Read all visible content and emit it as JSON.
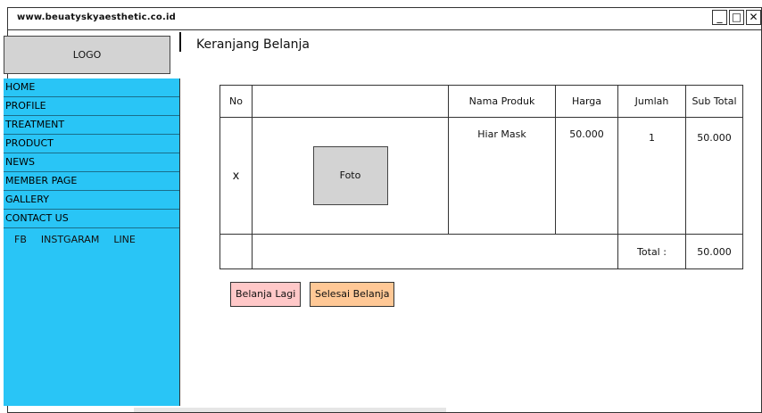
{
  "browser": {
    "url": "www.beuatyskyaesthetic.co.id",
    "min_icon": "minimize-icon",
    "max_icon": "maximize-icon",
    "close_icon": "close-icon"
  },
  "logo": {
    "label": "LOGO"
  },
  "sidebar": {
    "items": [
      {
        "label": "HOME"
      },
      {
        "label": "PROFILE"
      },
      {
        "label": "TREATMENT"
      },
      {
        "label": "PRODUCT"
      },
      {
        "label": "NEWS"
      },
      {
        "label": "MEMBER PAGE"
      },
      {
        "label": "GALLERY"
      },
      {
        "label": "CONTACT US"
      }
    ],
    "social": [
      "FB",
      "INSTGARAM",
      "LINE"
    ],
    "color": "#29c5f6"
  },
  "page": {
    "title": "Keranjang Belanja"
  },
  "cart": {
    "headers": {
      "no": "No",
      "product": "Nama Produk",
      "price": "Harga",
      "qty": "Jumlah",
      "subtotal": "Sub Total"
    },
    "row": {
      "remove": "x",
      "photo": "Foto",
      "product": "Hiar Mask",
      "price": "50.000",
      "qty": "1",
      "subtotal": "50.000"
    },
    "total_label": "Total :",
    "total_value": "50.000"
  },
  "actions": {
    "continue": {
      "label": "Belanja Lagi",
      "color": "#ffc8c8"
    },
    "checkout": {
      "label": "Selesai Belanja",
      "color": "#ffc896"
    }
  }
}
